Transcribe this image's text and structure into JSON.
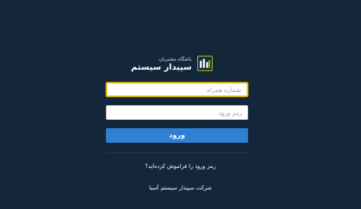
{
  "app": {
    "logo_subtitle": "باشگاه مشتریان",
    "logo_title": "سپیدار سیستم"
  },
  "form": {
    "phone_placeholder": "شماره همراه",
    "phone_value": "",
    "password_placeholder": "رمز ورود",
    "password_value": "",
    "login_label": "ورود"
  },
  "links": {
    "forgot_password": "رمز ورود را فراموش کرده‌اید؟"
  },
  "footer": {
    "company": "شرکت سپیدار سیستم آسیا"
  },
  "colors": {
    "background": "#14273a",
    "accent": "#2f7fd2",
    "focus": "#f1c40f",
    "logo_accent": "#c8d400"
  },
  "icons": {
    "logo": "sepidar-logo-icon"
  }
}
